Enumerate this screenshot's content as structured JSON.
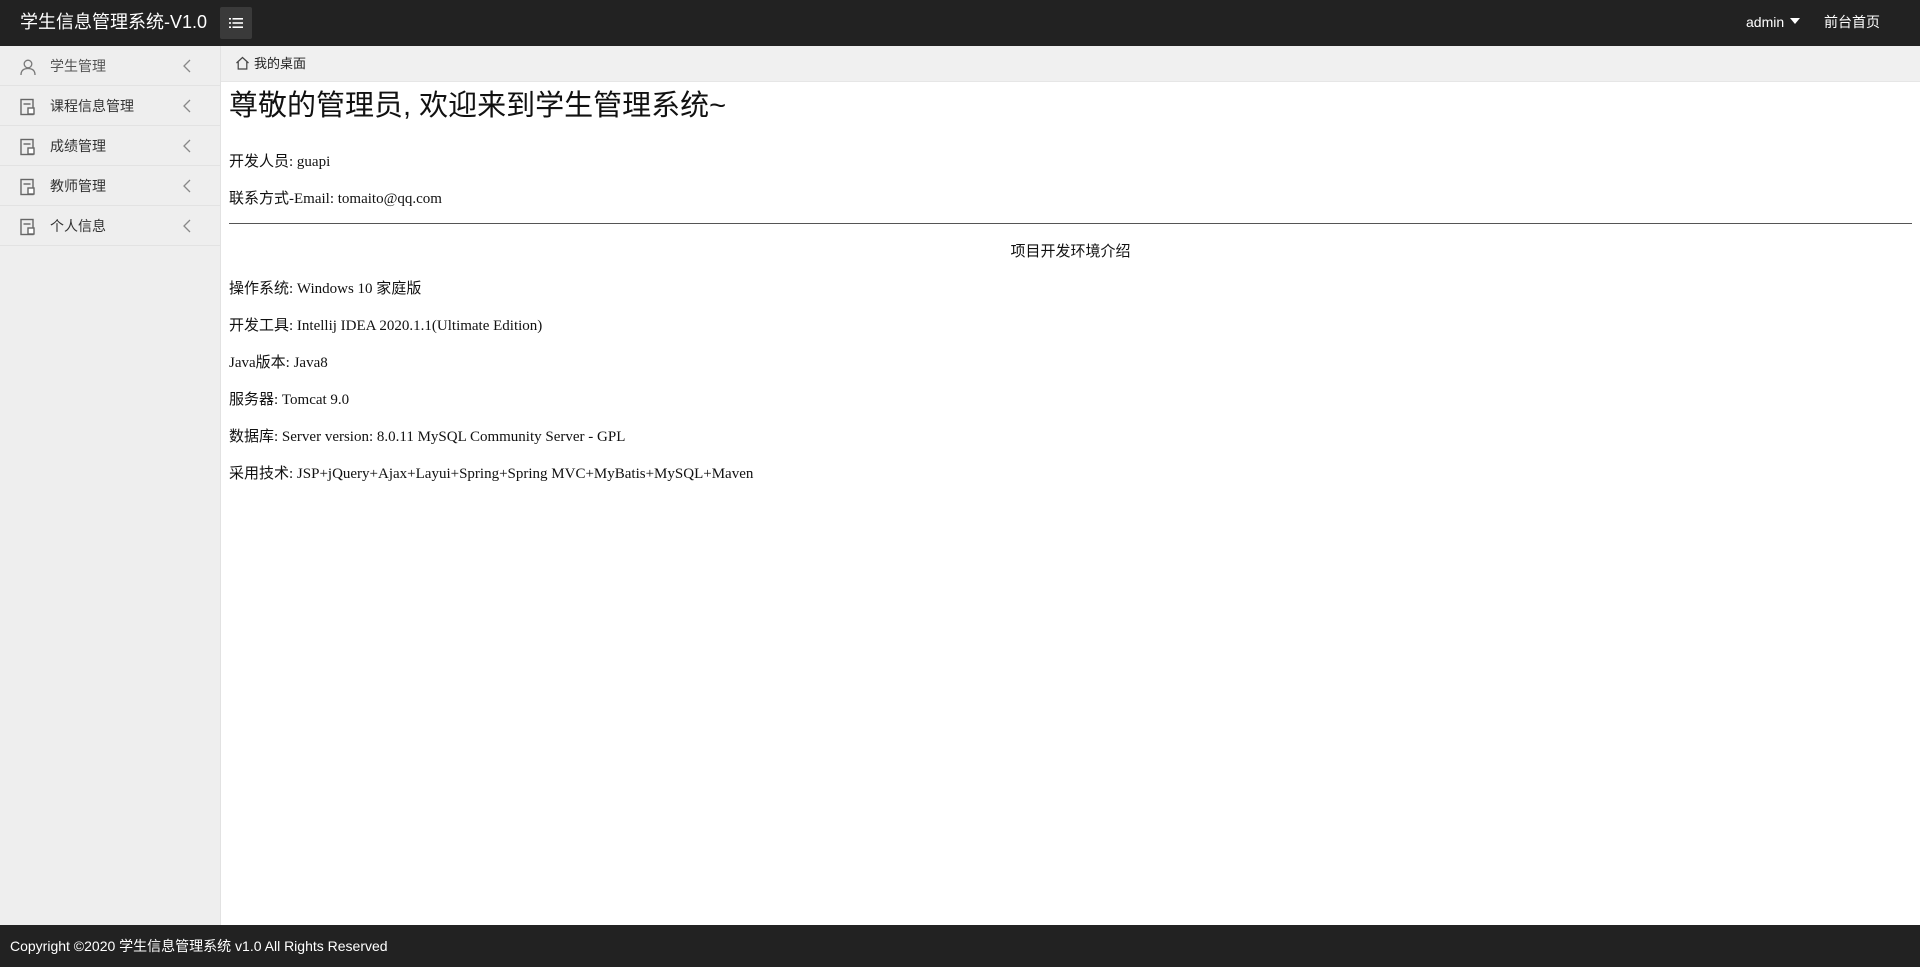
{
  "header": {
    "logo": "学生信息管理系统-V1.0",
    "menu_toggle_icon": "list-icon",
    "user": "admin",
    "home_link": "前台首页"
  },
  "sidebar": {
    "items": [
      {
        "label": "学生管理",
        "icon": "user-icon"
      },
      {
        "label": "课程信息管理",
        "icon": "document-icon"
      },
      {
        "label": "成绩管理",
        "icon": "document-icon"
      },
      {
        "label": "教师管理",
        "icon": "document-icon"
      },
      {
        "label": "个人信息",
        "icon": "document-icon"
      }
    ]
  },
  "tabbar": {
    "home_tab": "我的桌面"
  },
  "main": {
    "welcome": "尊敬的管理员, 欢迎来到学生管理系统~",
    "developer": "开发人员: guapi",
    "contact": "联系方式-Email: tomaito@qq.com",
    "section_title": "项目开发环境介绍",
    "env": [
      "操作系统: Windows 10 家庭版",
      "开发工具: Intellij IDEA 2020.1.1(Ultimate Edition)",
      "Java版本: Java8",
      "服务器: Tomcat 9.0",
      "数据库: Server version: 8.0.11 MySQL Community Server - GPL",
      "采用技术: JSP+jQuery+Ajax+Layui+Spring+Spring MVC+MyBatis+MySQL+Maven"
    ]
  },
  "footer": {
    "copyright": "Copyright ©2020 学生信息管理系统 v1.0 All Rights Reserved"
  },
  "colors": {
    "header_bg": "#222222",
    "sidebar_bg": "#eeeeee",
    "tabbar_bg": "#f0f0f0"
  }
}
